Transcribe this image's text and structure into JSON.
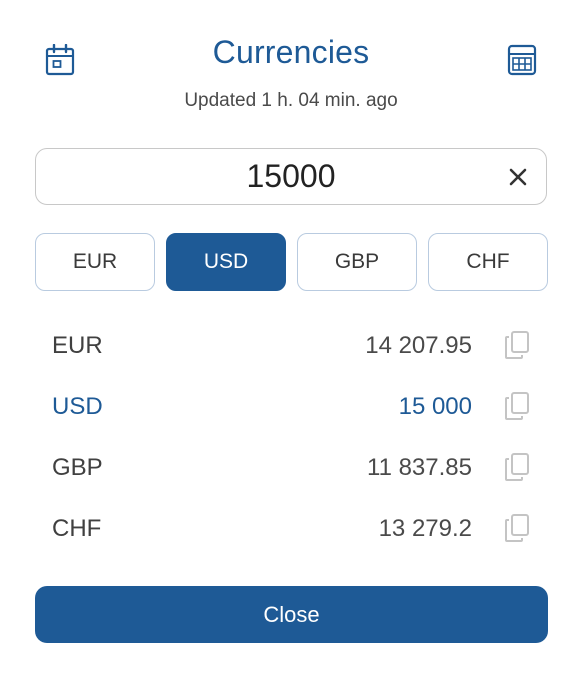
{
  "header": {
    "title": "Currencies",
    "updated": "Updated 1 h. 04 min. ago"
  },
  "icons": {
    "left": "calendar-icon",
    "right": "calculator-icon",
    "clear": "close-icon",
    "copy": "copy-icon"
  },
  "amount": {
    "value": "15000"
  },
  "tabs": [
    {
      "label": "EUR",
      "active": false
    },
    {
      "label": "USD",
      "active": true
    },
    {
      "label": "GBP",
      "active": false
    },
    {
      "label": "CHF",
      "active": false
    }
  ],
  "rates": [
    {
      "code": "EUR",
      "value": "14 207.95",
      "active": false
    },
    {
      "code": "USD",
      "value": "15 000",
      "active": true
    },
    {
      "code": "GBP",
      "value": "11 837.85",
      "active": false
    },
    {
      "code": "CHF",
      "value": "13 279.2",
      "active": false
    }
  ],
  "footer": {
    "close_label": "Close"
  },
  "colors": {
    "accent": "#1e5a96",
    "icon": "#1e5a96",
    "copy_icon": "#c4c4c4"
  }
}
